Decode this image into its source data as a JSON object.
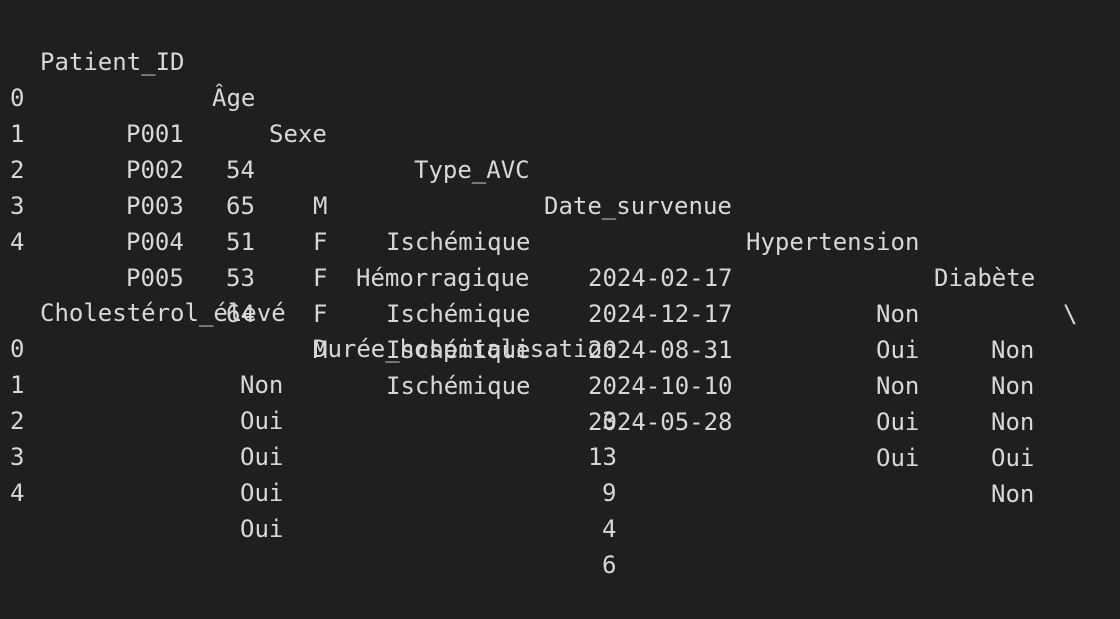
{
  "colors": {
    "background": "#1f1f1f",
    "text": "#d7d7d7"
  },
  "table_part1": {
    "headers": {
      "patient_id": "Patient_ID",
      "age": "Âge",
      "sexe": "Sexe",
      "type_avc": "Type_AVC",
      "date_survenue": "Date_survenue",
      "hypertension": "Hypertension",
      "diabete": "Diabète",
      "continuation": "\\"
    },
    "rows": [
      {
        "index": "0",
        "patient_id": "P001",
        "age": "54",
        "sexe": "M",
        "type_avc": "Ischémique",
        "date_survenue": "2024-02-17",
        "hypertension": "Non",
        "diabete": "Non"
      },
      {
        "index": "1",
        "patient_id": "P002",
        "age": "65",
        "sexe": "F",
        "type_avc": "Hémorragique",
        "date_survenue": "2024-12-17",
        "hypertension": "Oui",
        "diabete": "Non"
      },
      {
        "index": "2",
        "patient_id": "P003",
        "age": "51",
        "sexe": "F",
        "type_avc": "Ischémique",
        "date_survenue": "2024-08-31",
        "hypertension": "Non",
        "diabete": "Non"
      },
      {
        "index": "3",
        "patient_id": "P004",
        "age": "53",
        "sexe": "F",
        "type_avc": "Ischémique",
        "date_survenue": "2024-10-10",
        "hypertension": "Oui",
        "diabete": "Oui"
      },
      {
        "index": "4",
        "patient_id": "P005",
        "age": "64",
        "sexe": "M",
        "type_avc": "Ischémique",
        "date_survenue": "2024-05-28",
        "hypertension": "Oui",
        "diabete": "Non"
      }
    ]
  },
  "table_part2": {
    "headers": {
      "cholesterol_eleve": "Cholestérol_élevé",
      "duree_hospitalisation": "Durée_hospitalisation"
    },
    "rows": [
      {
        "index": "0",
        "cholesterol_eleve": "Non",
        "duree_hospitalisation": "3"
      },
      {
        "index": "1",
        "cholesterol_eleve": "Oui",
        "duree_hospitalisation": "13"
      },
      {
        "index": "2",
        "cholesterol_eleve": "Oui",
        "duree_hospitalisation": "9"
      },
      {
        "index": "3",
        "cholesterol_eleve": "Oui",
        "duree_hospitalisation": "4"
      },
      {
        "index": "4",
        "cholesterol_eleve": "Oui",
        "duree_hospitalisation": "6"
      }
    ]
  }
}
